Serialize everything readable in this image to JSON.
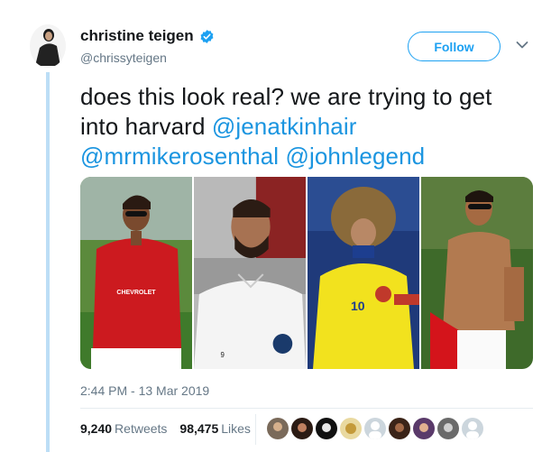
{
  "tweet": {
    "display_name": "christine teigen",
    "handle": "@chrissyteigen",
    "follow_label": "Follow",
    "text_lines": [
      {
        "plain": "does this look real? we are trying to get",
        "mention": ""
      },
      {
        "plain": "into harvard ",
        "mention": "@jenatkinhair"
      },
      {
        "plain": "",
        "mention": "@mrmikerosenthal"
      },
      {
        "plain": " ",
        "mention": "@johnlegend"
      }
    ],
    "timestamp": "2:44 PM - 13 Mar 2019",
    "retweets_count": "9,240",
    "retweets_label": "Retweets",
    "likes_count": "98,475",
    "likes_label": "Likes"
  },
  "colors": {
    "accent": "#1da1f2",
    "mention": "#1b95e0",
    "thread_line": "#bcdef6",
    "muted": "#657786"
  },
  "media": {
    "tiles": [
      {
        "id": "player-red-jersey",
        "jersey_text": "CHEVROLET"
      },
      {
        "id": "player-white-jersey",
        "jersey_text": "9"
      },
      {
        "id": "player-yellow-jersey",
        "jersey_text": "10"
      },
      {
        "id": "player-shirtless",
        "jersey_text": ""
      }
    ]
  },
  "likers_count": 9
}
